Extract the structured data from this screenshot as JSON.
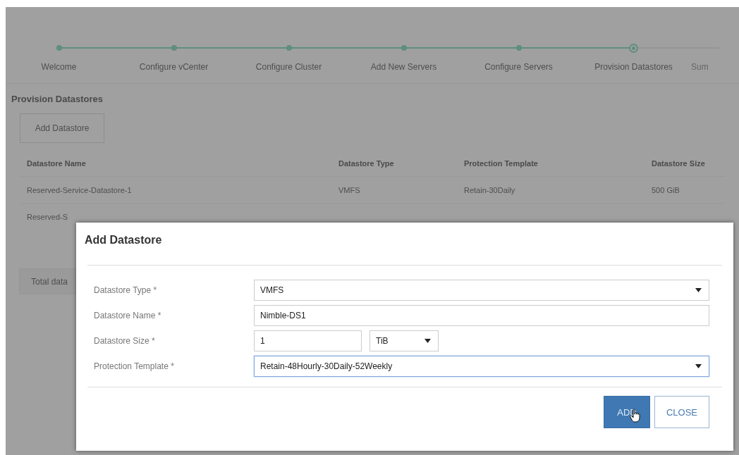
{
  "stepper": {
    "steps": [
      {
        "label": "Welcome",
        "completed": true,
        "selected": false
      },
      {
        "label": "Configure vCenter",
        "completed": true,
        "selected": false
      },
      {
        "label": "Configure Cluster",
        "completed": true,
        "selected": false
      },
      {
        "label": "Add New Servers",
        "completed": true,
        "selected": false
      },
      {
        "label": "Configure Servers",
        "completed": true,
        "selected": false
      },
      {
        "label": "Provision Datastores",
        "completed": false,
        "selected": true
      },
      {
        "label": "Sum",
        "completed": false,
        "selected": false
      }
    ]
  },
  "page": {
    "title": "Provision Datastores",
    "add_button": "Add Datastore",
    "table": {
      "columns": [
        "Datastore Name",
        "Datastore Type",
        "Protection Template",
        "Datastore Size"
      ],
      "rows": [
        [
          "Reserved-Service-Datastore-1",
          "VMFS",
          "Retain-30Daily",
          "500 GiB"
        ],
        [
          "Reserved-S"
        ]
      ]
    },
    "total": "Total data"
  },
  "dialog": {
    "title": "Add Datastore",
    "fields": [
      {
        "label": "Datastore Type *",
        "kind": "select",
        "value": "VMFS",
        "focused": false
      },
      {
        "label": "Datastore Name *",
        "kind": "text",
        "value": "Nimble-DS1",
        "focused": false
      },
      {
        "label": "Datastore Size *",
        "kind": "size",
        "value": "1",
        "unit": "TiB",
        "focused": false
      },
      {
        "label": "Protection Template *",
        "kind": "select",
        "value": "Retain-48Hourly-30Daily-52Weekly",
        "focused": true
      }
    ],
    "buttons": [
      {
        "label": "ADD",
        "kind": "primary"
      },
      {
        "label": "CLOSE",
        "kind": "secondary"
      }
    ]
  }
}
